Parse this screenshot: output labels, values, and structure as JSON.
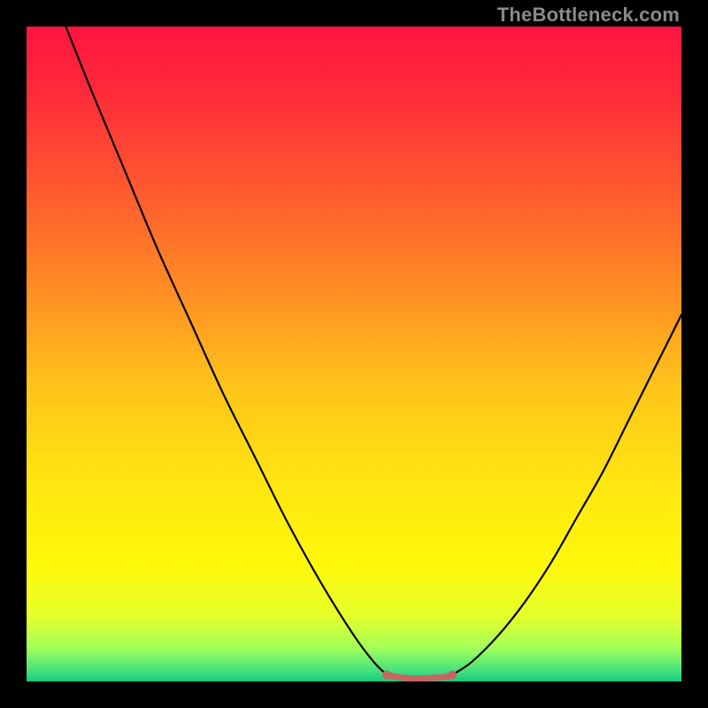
{
  "watermark": "TheBottleneck.com",
  "colors": {
    "frame": "#000000",
    "curve": "#000000",
    "trough_marker": "#c86464",
    "gradient_stops": [
      {
        "offset": 0.0,
        "hex": "#ff1440"
      },
      {
        "offset": 0.1,
        "hex": "#ff2a3a"
      },
      {
        "offset": 0.25,
        "hex": "#ff5a2f"
      },
      {
        "offset": 0.4,
        "hex": "#ff8c24"
      },
      {
        "offset": 0.55,
        "hex": "#ffc41a"
      },
      {
        "offset": 0.7,
        "hex": "#ffe610"
      },
      {
        "offset": 0.82,
        "hex": "#fff80a"
      },
      {
        "offset": 0.9,
        "hex": "#e6ff2a"
      },
      {
        "offset": 0.95,
        "hex": "#a0ff5a"
      },
      {
        "offset": 0.985,
        "hex": "#40e080"
      },
      {
        "offset": 1.0,
        "hex": "#18c878"
      }
    ]
  },
  "chart_data": {
    "type": "line",
    "title": "",
    "xlabel": "",
    "ylabel": "",
    "xlim": [
      0,
      100
    ],
    "ylim": [
      0,
      100
    ],
    "legend": false,
    "grid": false,
    "series": [
      {
        "name": "left-branch",
        "x": [
          6,
          10,
          15,
          20,
          25,
          30,
          35,
          40,
          45,
          50,
          53,
          55
        ],
        "y": [
          100,
          90,
          78,
          66,
          55,
          44,
          34,
          24,
          15,
          7,
          3,
          1
        ]
      },
      {
        "name": "right-branch",
        "x": [
          65,
          68,
          72,
          76,
          80,
          84,
          88,
          92,
          96,
          100
        ],
        "y": [
          1,
          3,
          7,
          12,
          18,
          25,
          32,
          40,
          48,
          56
        ]
      },
      {
        "name": "trough-flat",
        "x": [
          55,
          58,
          61,
          64,
          65
        ],
        "y": [
          1,
          0.5,
          0.5,
          0.7,
          1
        ]
      }
    ],
    "annotations": [
      {
        "type": "marker",
        "name": "optimal-range",
        "x_start": 55,
        "x_end": 65,
        "y": 1
      }
    ]
  }
}
